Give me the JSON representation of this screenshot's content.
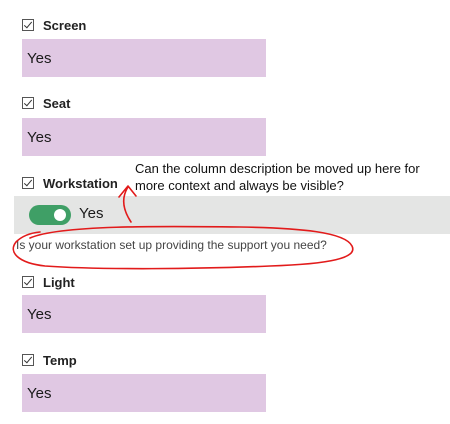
{
  "fields": [
    {
      "label": "Screen",
      "value": "Yes"
    },
    {
      "label": "Seat",
      "value": "Yes"
    },
    {
      "label": "Workstation",
      "toggle_value": "Yes",
      "description": "Is your workstation set up providing the support you need?"
    },
    {
      "label": "Light",
      "value": "Yes"
    },
    {
      "label": "Temp",
      "value": "Yes"
    }
  ],
  "annotation": {
    "comment": "Can the column description be moved up here for more context and always be visible?",
    "color": "#e21b1b"
  },
  "colors": {
    "value_fill": "#e0c8e3",
    "toggle_on": "#3f9f66",
    "toggle_row_bg": "#e4e5e4"
  },
  "icons": {
    "checkbox": "checkbox-checked-icon"
  }
}
